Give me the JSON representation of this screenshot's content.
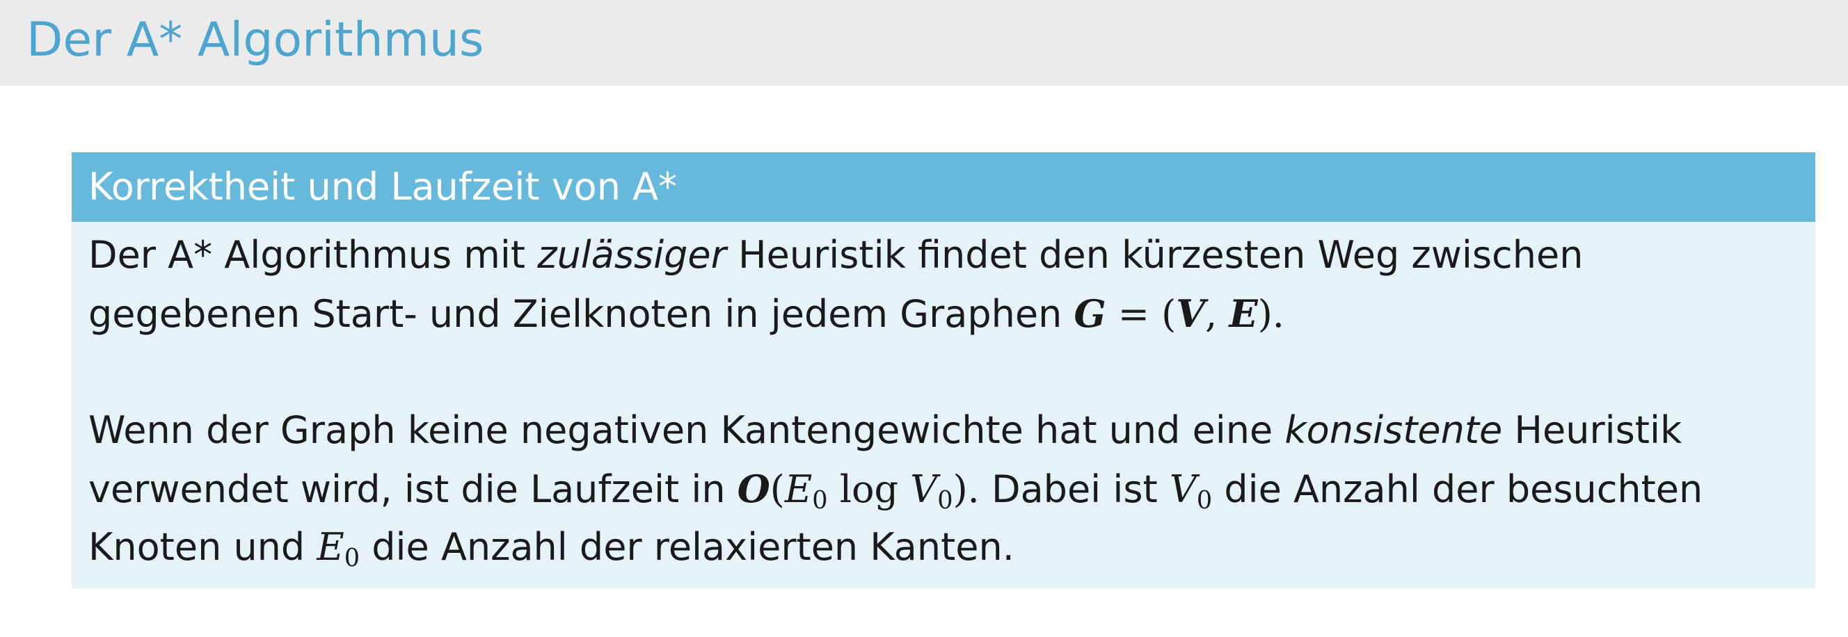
{
  "frame": {
    "title": "Der A* Algorithmus"
  },
  "block": {
    "title": "Korrektheit und Laufzeit von A*",
    "p1": {
      "a": "Der A* Algorithmus mit ",
      "em": "zulässiger",
      "b": " Heuristik findet den kürzesten Weg zwischen",
      "c": "gegebenen Start- und Zielknoten in jedem Graphen ",
      "formula": {
        "G": "G",
        "eq": " = (",
        "V": "V",
        "comma": ", ",
        "E": "E",
        "close": ")."
      }
    },
    "p2": {
      "a": "Wenn der Graph keine negativen Kantengewichte hat und eine ",
      "em": "konsistente",
      "b": " Heuristik",
      "c": "verwendet wird, ist die Laufzeit in ",
      "bigO": {
        "O": "O",
        "open": "(",
        "E": "E",
        "sub": "0",
        "log": " log ",
        "V": "V",
        "sub2": "0",
        "close": ")."
      },
      "d": " Dabei ist ",
      "V0": {
        "V": "V",
        "sub": "0"
      },
      "e": " die Anzahl der besuchten",
      "f": "Knoten und ",
      "E0": {
        "E": "E",
        "sub": "0"
      },
      "g": " die Anzahl der relaxierten Kanten."
    }
  }
}
